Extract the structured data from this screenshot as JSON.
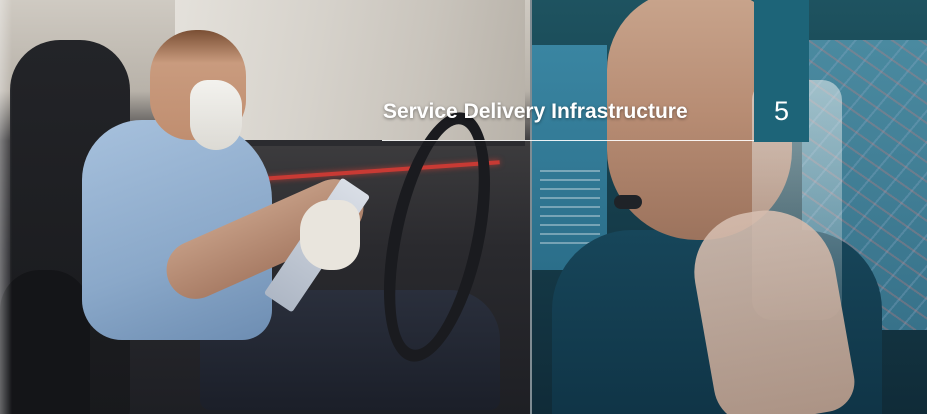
{
  "header": {
    "section_title": "Service Delivery Infrastructure",
    "page_number": "5"
  },
  "colors": {
    "page_box": "#1d6478",
    "title_text": "#ffffff",
    "rule_line": "#ffffff"
  }
}
